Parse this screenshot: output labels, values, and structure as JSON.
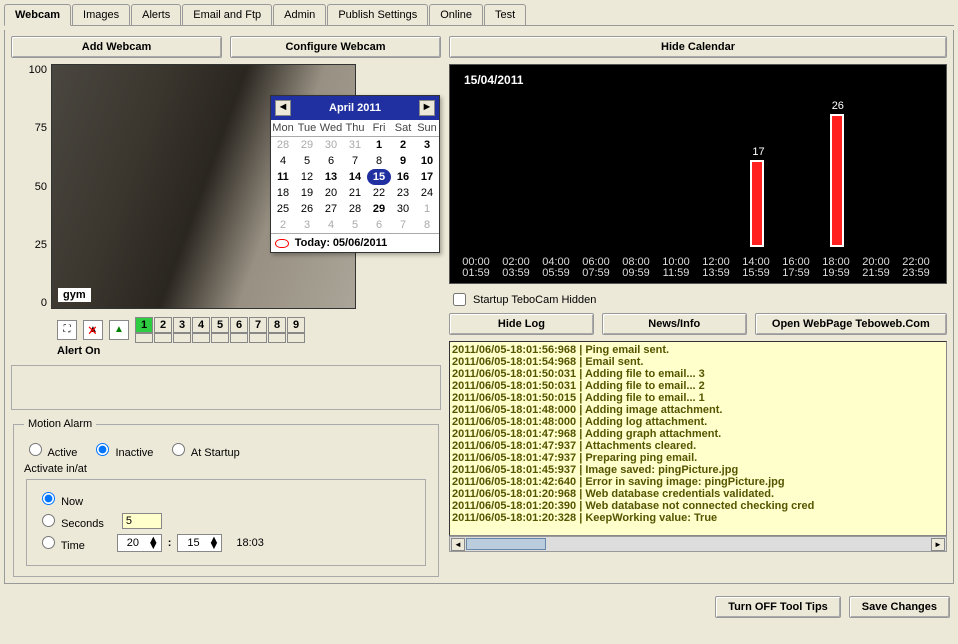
{
  "tabs": [
    "Webcam",
    "Images",
    "Alerts",
    "Email and Ftp",
    "Admin",
    "Publish Settings",
    "Online",
    "Test"
  ],
  "active_tab": 0,
  "buttons": {
    "add_webcam": "Add Webcam",
    "configure_webcam": "Configure Webcam",
    "hide_calendar": "Hide Calendar",
    "hide_log": "Hide Log",
    "news_info": "News/Info",
    "open_webpage": "Open WebPage Teboweb.Com",
    "turn_off_tooltips": "Turn OFF Tool Tips",
    "save_changes": "Save Changes"
  },
  "yaxis": [
    "100",
    "75",
    "50",
    "25",
    "0"
  ],
  "webcam_label": "gym",
  "calendar": {
    "title": "April 2011",
    "headers": [
      "Mon",
      "Tue",
      "Wed",
      "Thu",
      "Fri",
      "Sat",
      "Sun"
    ],
    "days": [
      {
        "n": "28",
        "t": "g"
      },
      {
        "n": "29",
        "t": "g"
      },
      {
        "n": "30",
        "t": "g"
      },
      {
        "n": "31",
        "t": "g"
      },
      {
        "n": "1",
        "t": "b"
      },
      {
        "n": "2",
        "t": "b"
      },
      {
        "n": "3",
        "t": "b"
      },
      {
        "n": "4"
      },
      {
        "n": "5"
      },
      {
        "n": "6"
      },
      {
        "n": "7"
      },
      {
        "n": "8"
      },
      {
        "n": "9",
        "t": "b"
      },
      {
        "n": "10",
        "t": "b"
      },
      {
        "n": "11",
        "t": "b"
      },
      {
        "n": "12"
      },
      {
        "n": "13",
        "t": "b"
      },
      {
        "n": "14",
        "t": "b"
      },
      {
        "n": "15",
        "t": "sel"
      },
      {
        "n": "16",
        "t": "b"
      },
      {
        "n": "17",
        "t": "b"
      },
      {
        "n": "18"
      },
      {
        "n": "19"
      },
      {
        "n": "20"
      },
      {
        "n": "21"
      },
      {
        "n": "22"
      },
      {
        "n": "23"
      },
      {
        "n": "24"
      },
      {
        "n": "25"
      },
      {
        "n": "26"
      },
      {
        "n": "27"
      },
      {
        "n": "28"
      },
      {
        "n": "29",
        "t": "b"
      },
      {
        "n": "30"
      },
      {
        "n": "1",
        "t": "g"
      },
      {
        "n": "2",
        "t": "g"
      },
      {
        "n": "3",
        "t": "g"
      },
      {
        "n": "4",
        "t": "g"
      },
      {
        "n": "5",
        "t": "g"
      },
      {
        "n": "6",
        "t": "g"
      },
      {
        "n": "7",
        "t": "g"
      },
      {
        "n": "8",
        "t": "g"
      }
    ],
    "today_label": "Today:",
    "today_date": "05/06/2011"
  },
  "alert_on_label": "Alert On",
  "cam_numbers": [
    "1",
    "2",
    "3",
    "4",
    "5",
    "6",
    "7",
    "8",
    "9"
  ],
  "active_cam": 0,
  "motion_alarm": {
    "legend": "Motion Alarm",
    "active": "Active",
    "inactive": "Inactive",
    "at_startup": "At Startup",
    "selected_state": "Inactive",
    "activate_label": "Activate in/at",
    "now": "Now",
    "seconds": "Seconds",
    "seconds_val": "5",
    "time": "Time",
    "time_h": "20",
    "time_m": "15",
    "time_display": "18:03",
    "selected_when": "Now"
  },
  "chart_data": {
    "type": "bar",
    "title": "15/04/2011",
    "categories": [
      "00:00",
      "02:00",
      "04:00",
      "06:00",
      "08:00",
      "10:00",
      "12:00",
      "14:00",
      "16:00",
      "18:00",
      "20:00",
      "22:00"
    ],
    "categories2": [
      "01:59",
      "03:59",
      "05:59",
      "07:59",
      "09:59",
      "11:59",
      "13:59",
      "15:59",
      "17:59",
      "19:59",
      "21:59",
      "23:59"
    ],
    "values": [
      0,
      0,
      0,
      0,
      0,
      0,
      0,
      17,
      0,
      26,
      0,
      0
    ],
    "ylim": [
      0,
      30
    ]
  },
  "startup_hidden_label": "Startup TeboCam Hidden",
  "startup_hidden_checked": false,
  "log": [
    "2011/06/05-18:01:56:968 | Ping email sent.",
    "2011/06/05-18:01:54:968 | Email sent.",
    "2011/06/05-18:01:50:031 | Adding file to email... 3",
    "2011/06/05-18:01:50:031 | Adding file to email... 2",
    "2011/06/05-18:01:50:015 | Adding file to email... 1",
    "2011/06/05-18:01:48:000 | Adding image attachment.",
    "2011/06/05-18:01:48:000 | Adding log attachment.",
    "2011/06/05-18:01:47:968 | Adding graph attachment.",
    "2011/06/05-18:01:47:937 | Attachments cleared.",
    "2011/06/05-18:01:47:937 | Preparing ping email.",
    "2011/06/05-18:01:45:937 | Image saved: pingPicture.jpg",
    "2011/06/05-18:01:42:640 | Error in saving image: pingPicture.jpg",
    "2011/06/05-18:01:20:968 | Web database credentials validated.",
    "2011/06/05-18:01:20:390 | Web database not connected checking cred",
    "2011/06/05-18:01:20:328 | KeepWorking value: True"
  ]
}
